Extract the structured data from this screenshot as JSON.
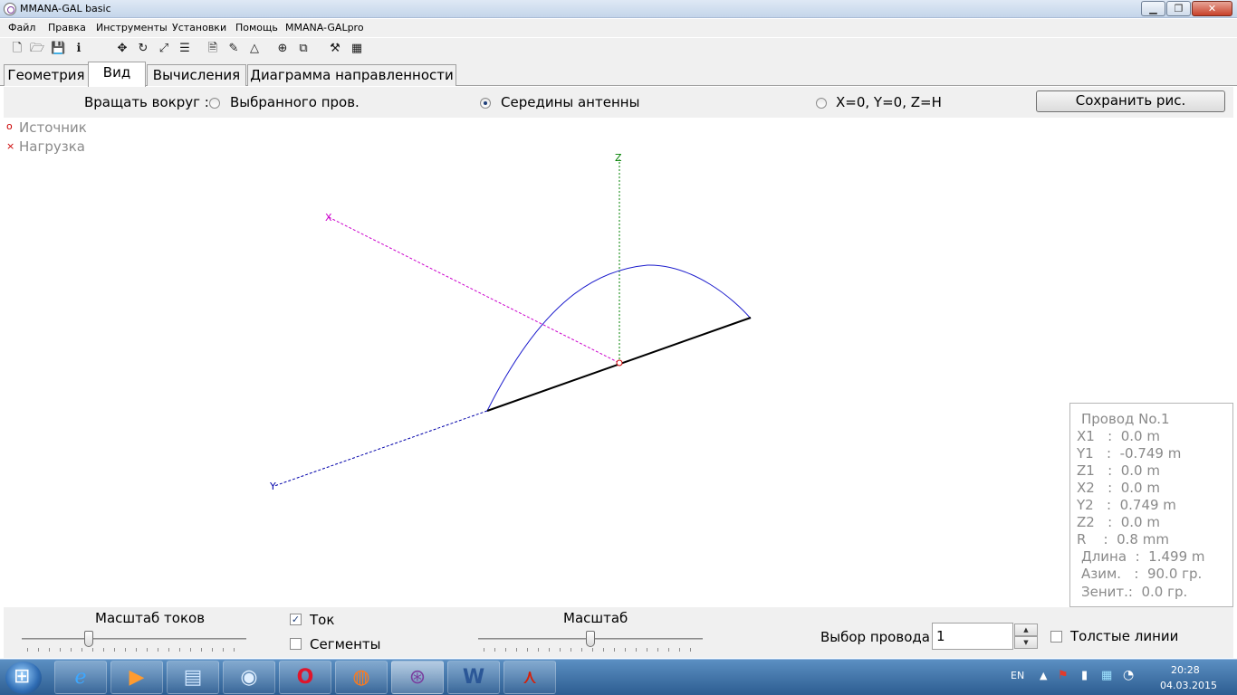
{
  "window": {
    "title": "MMANA-GAL basic",
    "buttons": {
      "minimize": "▁",
      "maximize": "❐",
      "close": "✕"
    }
  },
  "menu": [
    "Файл",
    "Правка",
    "Инструменты",
    "Установки",
    "Помощь",
    "MMANA-GALpro"
  ],
  "toolbar": {
    "icons": [
      "new-file-icon",
      "open-folder-icon",
      "save-disk-icon",
      "info-icon",
      "move-arrows-icon",
      "rotate-icon",
      "zoom-window-icon",
      "lines-icon",
      "page-icon",
      "pen-icon",
      "triangle-icon",
      "crosshair-icon",
      "copy-icon",
      "tools-icon",
      "calculator-icon"
    ]
  },
  "tabs": [
    {
      "label": "Геометрия",
      "active": false
    },
    {
      "label": "Вид",
      "active": true
    },
    {
      "label": "Вычисления",
      "active": false
    },
    {
      "label": "Диаграмма направленности",
      "active": false
    }
  ],
  "rotate": {
    "label": "Вращать вокруг :",
    "options": [
      {
        "label": "Выбранного пров.",
        "selected": false
      },
      {
        "label": "Середины антенны",
        "selected": true
      },
      {
        "label": "X=0, Y=0, Z=H",
        "selected": false
      }
    ],
    "save_button": "Сохранить рис."
  },
  "legend": {
    "source_mark": "o",
    "source_label": "Источник",
    "load_mark": "×",
    "load_label": "Нагрузка"
  },
  "axes": {
    "x": "X",
    "y": "Y",
    "z": "Z"
  },
  "colors": {
    "x_axis": "#cc00cc",
    "y_axis": "#0000aa",
    "z_axis": "#008000",
    "current": "#1a1acc",
    "wire": "#000000",
    "source": "#cc0000"
  },
  "wire_info": {
    "title": "Провод No.1",
    "x1": "X1   :  0.0 m",
    "y1": "Y1   :  -0.749 m",
    "z1": "Z1   :  0.0 m",
    "x2": "X2   :  0.0 m",
    "y2": "Y2   :  0.749 m",
    "z2": "Z2   :  0.0 m",
    "r": "R    :  0.8 mm",
    "length": "Длина  :  1.499 m",
    "azimuth": "Азим.   :  90.0 гр.",
    "zenith": "Зенит.:  0.0 гр."
  },
  "bottom": {
    "current_scale_label": "Масштаб токов",
    "current_scale_value": 0.3,
    "current_checkbox": {
      "label": "Ток",
      "checked": true
    },
    "segments_checkbox": {
      "label": "Сегменты",
      "checked": false
    },
    "scale_label": "Масштаб",
    "scale_value": 0.5,
    "wire_select_label": "Выбор провода",
    "wire_select_value": "1",
    "thick_lines": {
      "label": "Толстые линии",
      "checked": false
    }
  },
  "taskbar": {
    "apps": [
      "ie-icon",
      "media-icon",
      "files-icon",
      "network-icon",
      "opera-icon",
      "firefox-icon",
      "mmana-icon",
      "word-icon",
      "pdf-icon"
    ],
    "lang": "EN",
    "time": "20:28",
    "date": "04.03.2015"
  }
}
